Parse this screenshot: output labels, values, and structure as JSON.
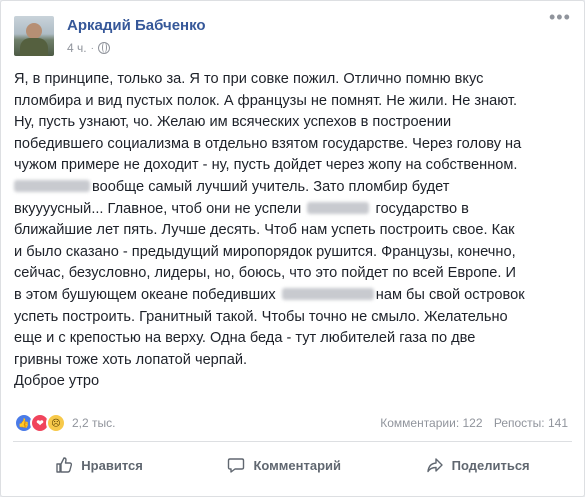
{
  "post": {
    "author": "Аркадий Бабченко",
    "time": "4 ч.",
    "separator": "·",
    "more_icon": "ellipsis-icon",
    "lines": [
      {
        "t1": "Я, в принципе, только за. Я то при совке пожил. Отлично помню вкус"
      },
      {
        "t1": "пломбира и вид пустых полок. А французы не помнят. Не жили. Не знают."
      },
      {
        "t1": "Ну, пусть узнают, чо. Желаю им всяческих успехов в построении"
      },
      {
        "t1": "победившего социализма в отдельно взятом государстве. Через голову на"
      },
      {
        "t1": "чужом примере не доходит - ну, пусть дойдет через жопу на собственном."
      },
      {
        "t1": "",
        "t2": "вообще самый лучший учитель. Зато пломбир будет"
      },
      {
        "t1": "вкуууусный... Главное, чтоб они не успели",
        "t2": "государство в"
      },
      {
        "t1": "ближайшие лет пять. Лучше десять. Чтоб нам успеть построить свое. Как"
      },
      {
        "t1": "и было сказано - предыдущий миропорядок рушится. Французы, конечно,"
      },
      {
        "t1": "сейчас, безусловно, лидеры, но, боюсь, что это пойдет по всей Европе. И"
      },
      {
        "t1": "в этом бушующем океане победивших",
        "t2": "нам бы свой островок"
      },
      {
        "t1": "успеть построить. Гранитный такой. Чтобы точно не смыло. Желательно"
      },
      {
        "t1": "еще и с крепостью на верху. Одна беда - тут любителей газа по две"
      },
      {
        "t1": "гривны тоже хоть лопатой черпай."
      },
      {
        "t1": "Доброе утро"
      }
    ]
  },
  "reactions": {
    "icons": [
      "like-icon",
      "love-icon",
      "sad-icon"
    ],
    "count": "2,2 тыс."
  },
  "stats": {
    "comments": "Комментарии: 122",
    "shares": "Репосты: 141"
  },
  "actions": {
    "like": "Нравится",
    "comment": "Комментарий",
    "share": "Поделиться"
  },
  "colors": {
    "link": "#365899",
    "text": "#1d2129",
    "muted": "#90949c",
    "action": "#606770"
  }
}
